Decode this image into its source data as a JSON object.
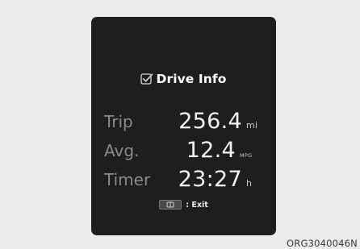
{
  "display": {
    "title": "Drive Info",
    "rows": [
      {
        "label": "Trip",
        "value": "256.4",
        "unit": "mi"
      },
      {
        "label": "Avg.",
        "value": "12.4",
        "unit": "MPG"
      },
      {
        "label": "Timer",
        "value": "23:27",
        "unit": "h"
      }
    ],
    "exit_label": ": Exit",
    "title_icon": "check-icon",
    "exit_icon": "button-key-icon"
  },
  "figure_code": "ORG3040046N"
}
